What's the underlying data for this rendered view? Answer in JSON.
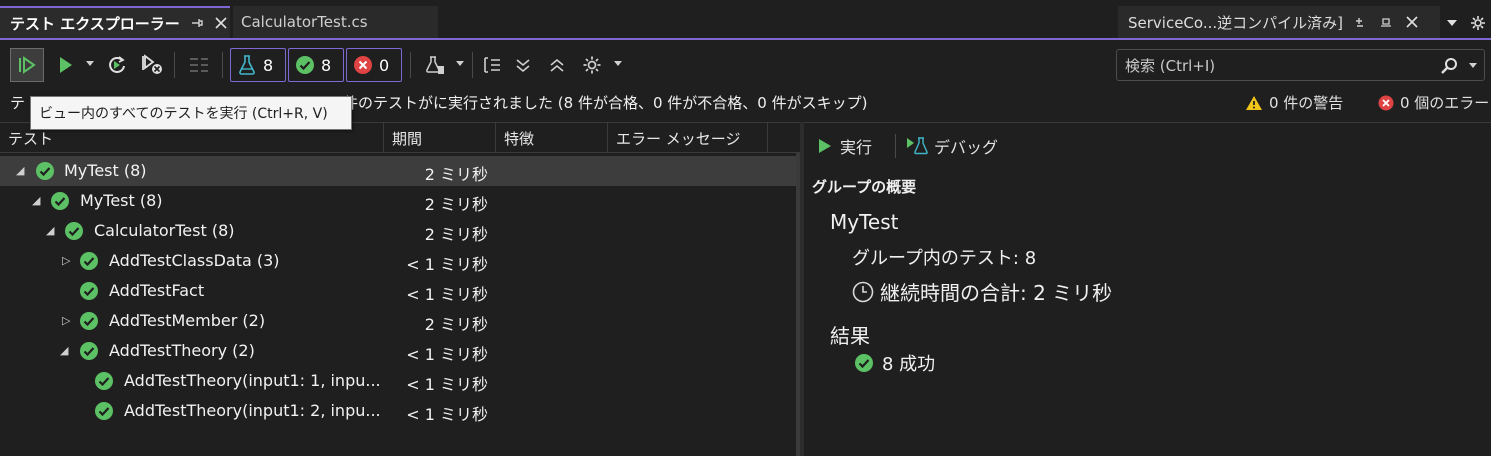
{
  "tabs": {
    "active_title": "テスト エクスプローラー",
    "inactive_title": "CalculatorTest.cs",
    "right_title": "ServiceCo...逆コンパイル済み]"
  },
  "toolbar": {
    "total_count": "8",
    "passed_count": "8",
    "failed_count": "0",
    "search_placeholder": "検索 (Ctrl+I)"
  },
  "status": {
    "summary_suffix": "件のテストがに実行されました (8 件が合格、0 件が不合格、0 件がスキップ)",
    "summary_prefix": "テ",
    "warnings": "0 件の警告",
    "errors": "0 個のエラー"
  },
  "tooltip": "ビュー内のすべてのテストを実行 (Ctrl+R, V)",
  "columns": [
    "テスト",
    "期間",
    "特徴",
    "エラー メッセージ"
  ],
  "tree": [
    {
      "name": "MyTest",
      "count": "(8)",
      "duration": "2 ミリ秒"
    },
    {
      "name": "MyTest",
      "count": "(8)",
      "duration": "2 ミリ秒"
    },
    {
      "name": "CalculatorTest",
      "count": "(8)",
      "duration": "2 ミリ秒"
    },
    {
      "name": "AddTestClassData",
      "count": "(3)",
      "duration": "< 1 ミリ秒"
    },
    {
      "name": "AddTestFact",
      "count": "",
      "duration": "< 1 ミリ秒"
    },
    {
      "name": "AddTestMember",
      "count": "(2)",
      "duration": "2 ミリ秒"
    },
    {
      "name": "AddTestTheory",
      "count": "(2)",
      "duration": "< 1 ミリ秒"
    },
    {
      "name": "AddTestTheory(input1: 1, inpu...",
      "count": "",
      "duration": "< 1 ミリ秒"
    },
    {
      "name": "AddTestTheory(input1: 2, inpu...",
      "count": "",
      "duration": "< 1 ミリ秒"
    }
  ],
  "details": {
    "run_label": "実行",
    "debug_label": "デバッグ",
    "section_title": "グループの概要",
    "group_name": "MyTest",
    "tests_in_group": "グループ内のテスト: 8",
    "total_duration": "継続時間の合計: 2 ミリ秒",
    "results_title": "結果",
    "passed_summary": "8 成功"
  },
  "colors": {
    "accent": "#7f68d4",
    "pass": "#5cc164",
    "fail": "#e04343",
    "warn": "#f0c419"
  }
}
